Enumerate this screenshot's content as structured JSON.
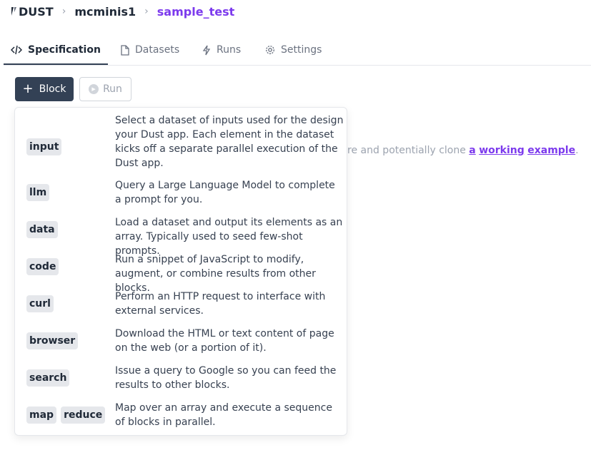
{
  "breadcrumb": {
    "logo": "DUST",
    "user": "mcminis1",
    "app": "sample_test"
  },
  "tabs": [
    {
      "label": "Specification",
      "icon": "code-icon",
      "active": true
    },
    {
      "label": "Datasets",
      "icon": "document-icon",
      "active": false
    },
    {
      "label": "Runs",
      "icon": "bolt-icon",
      "active": false
    },
    {
      "label": "Settings",
      "icon": "gear-icon",
      "active": false
    }
  ],
  "toolbar": {
    "block_label": "Block",
    "run_label": "Run"
  },
  "background": {
    "text": "re and potentially clone",
    "link_a": "a",
    "link_working": "working",
    "link_example": "example",
    "trailing": "."
  },
  "menu": {
    "items": [
      {
        "tags": [
          "input"
        ],
        "description": "Select a dataset of inputs used for the design your Dust app. Each element in the dataset kicks off a separate parallel execution of the Dust app."
      },
      {
        "tags": [
          "llm"
        ],
        "description": "Query a Large Language Model to complete a prompt for you."
      },
      {
        "tags": [
          "data"
        ],
        "description": "Load a dataset and output its elements as an array. Typically used to seed few-shot prompts."
      },
      {
        "tags": [
          "code"
        ],
        "description": "Run a snippet of JavaScript to modify, augment, or combine results from other blocks."
      },
      {
        "tags": [
          "curl"
        ],
        "description": "Perform an HTTP request to interface with external services."
      },
      {
        "tags": [
          "browser"
        ],
        "description": "Download the HTML or text content of page on the web (or a portion of it)."
      },
      {
        "tags": [
          "search"
        ],
        "description": "Issue a query to Google so you can feed the results to other blocks."
      },
      {
        "tags": [
          "map",
          "reduce"
        ],
        "description": "Map over an array and execute a sequence of blocks in parallel."
      }
    ]
  },
  "colors": {
    "accent": "#7c3aed",
    "primary_button": "#334155"
  }
}
